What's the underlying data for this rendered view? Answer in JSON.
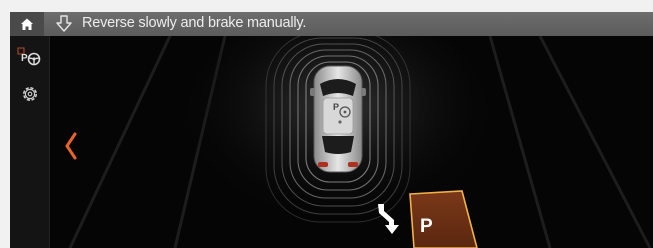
{
  "status_bar": {
    "message": "Reverse slowly and brake manually.",
    "home_icon": "home-icon",
    "message_icon": "arrow-down-icon"
  },
  "sidebar": {
    "items": [
      {
        "icon": "park-assist-icon",
        "label": "PA"
      },
      {
        "icon": "gear-icon"
      }
    ]
  },
  "parking": {
    "space_label": "P",
    "car_label": "P",
    "back_icon": "chevron-left-icon",
    "direction_icon": "reverse-turn-arrow-icon"
  },
  "colors": {
    "accent": "#e8642a",
    "space_fill": "#7a3818",
    "space_border": "#f2b24a",
    "status_bar": "#636363"
  }
}
